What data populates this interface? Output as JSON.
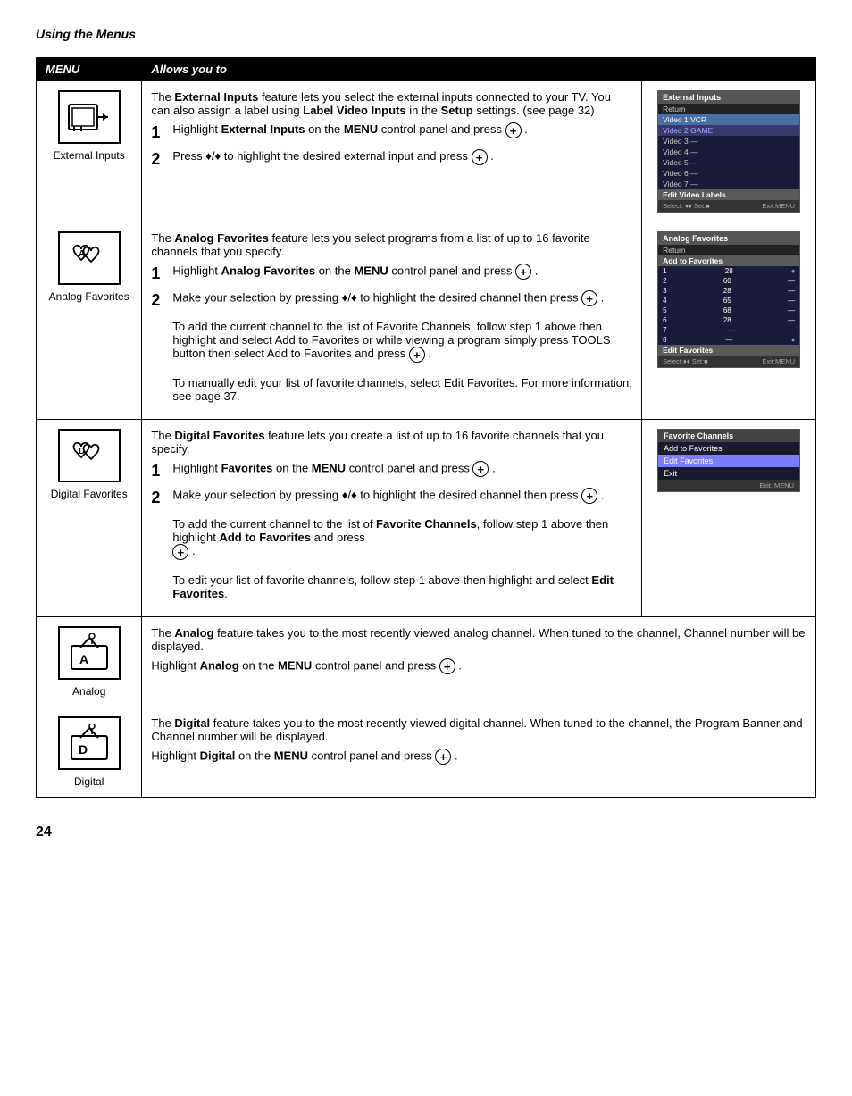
{
  "page": {
    "title": "Using the Menus",
    "page_number": "24"
  },
  "table": {
    "col1_header": "MENU",
    "col2_header": "Allows you to"
  },
  "rows": [
    {
      "id": "external-inputs",
      "icon_label": "External Inputs",
      "intro": "The External Inputs feature lets you select the external inputs connected to your TV. You can also assign a label using Label Video Inputs in the Setup settings. (see page 32)",
      "steps": [
        {
          "num": "1",
          "text": "Highlight External Inputs on the MENU control panel and press"
        },
        {
          "num": "2",
          "text": "Press ♦/♦ to highlight the desired external input and press"
        }
      ],
      "screen": {
        "header": "External Inputs",
        "return": "Return",
        "items": [
          {
            "label": "Video 1 VCR",
            "highlighted": true
          },
          {
            "label": "Video 2 GAME",
            "highlighted": false
          },
          {
            "label": "Video 3 —",
            "highlighted": false
          },
          {
            "label": "Video 4 —",
            "highlighted": false
          },
          {
            "label": "Video 5 —",
            "highlighted": false
          },
          {
            "label": "Video 6 —",
            "highlighted": false
          },
          {
            "label": "Video 7 —",
            "highlighted": false
          }
        ],
        "edit_label": "Edit Video Labels",
        "footer_select": "Select: ♦♦ Set: ■",
        "footer_exit": "Exit: MENU"
      }
    },
    {
      "id": "analog-favorites",
      "icon_label": "Analog Favorites",
      "intro": "The Analog Favorites feature lets you select programs from a list of up to 16 favorite channels that you specify.",
      "steps": [
        {
          "num": "1",
          "text": "Highlight Analog Favorites on the MENU control panel and press"
        },
        {
          "num": "2",
          "text": "Make your selection by pressing ♦/♦ to highlight the desired channel then press"
        }
      ],
      "extra_text_1": "To add the current channel to the list of Favorite Channels, follow step 1 above then highlight and select Add to Favorites or while viewing a program simply press TOOLS button then select Add to Favorites and press",
      "extra_text_2": "To manually edit your list of favorite channels, select Edit Favorites. For more information, see page 37.",
      "screen": {
        "header": "Analog Favorites",
        "return": "Return",
        "section": "Add to Favorites",
        "items": [
          {
            "num": "1",
            "ch": "28",
            "extra": "♦"
          },
          {
            "num": "2",
            "ch": "60",
            "extra": "—"
          },
          {
            "num": "3",
            "ch": "28",
            "extra": "—"
          },
          {
            "num": "4",
            "ch": "65",
            "extra": "—"
          },
          {
            "num": "5",
            "ch": "68",
            "extra": "—"
          },
          {
            "num": "6",
            "ch": "28",
            "extra": "—"
          },
          {
            "num": "7",
            "ch": "—",
            "extra": ""
          },
          {
            "num": "8",
            "ch": "—",
            "extra": "♦"
          }
        ],
        "edit_label": "Edit Favorites",
        "footer_select": "Select: ♦♦ Set: ■",
        "footer_exit": "Exit: MENU"
      }
    },
    {
      "id": "digital-favorites",
      "icon_label": "Digital Favorites",
      "intro": "The Digital Favorites feature lets you create a list of up to 16 favorite channels that you specify.",
      "steps": [
        {
          "num": "1",
          "text": "Highlight Favorites on the MENU control panel and press"
        },
        {
          "num": "2",
          "text": "Make your selection by pressing ♦/♦ to highlight the desired channel then press"
        }
      ],
      "extra_text_1": "To add the current channel to the list of Favorite Channels, follow step 1 above then highlight Add to Favorites and press",
      "extra_text_2": "To edit your list of favorite channels, follow step 1 above then highlight and select Edit Favorites.",
      "screen": {
        "header": "Favorite Channels",
        "items": [
          {
            "label": "Add to Favorites",
            "highlighted": false
          },
          {
            "label": "Edit Favorites",
            "highlighted": true
          },
          {
            "label": "Exit",
            "highlighted": false
          }
        ],
        "footer_exit": "Exit: MENU"
      }
    },
    {
      "id": "analog",
      "icon_label": "Analog",
      "text": "The Analog feature takes you to the most recently viewed analog channel. When tuned to the channel, Channel number will be displayed.",
      "instruction": "Highlight Analog on the MENU control panel and press"
    },
    {
      "id": "digital",
      "icon_label": "Digital",
      "text": "The Digital feature takes you to the most recently viewed digital channel. When tuned to the channel, the Program Banner and Channel number will be displayed.",
      "instruction": "Highlight Digital on the MENU control panel and press"
    }
  ]
}
